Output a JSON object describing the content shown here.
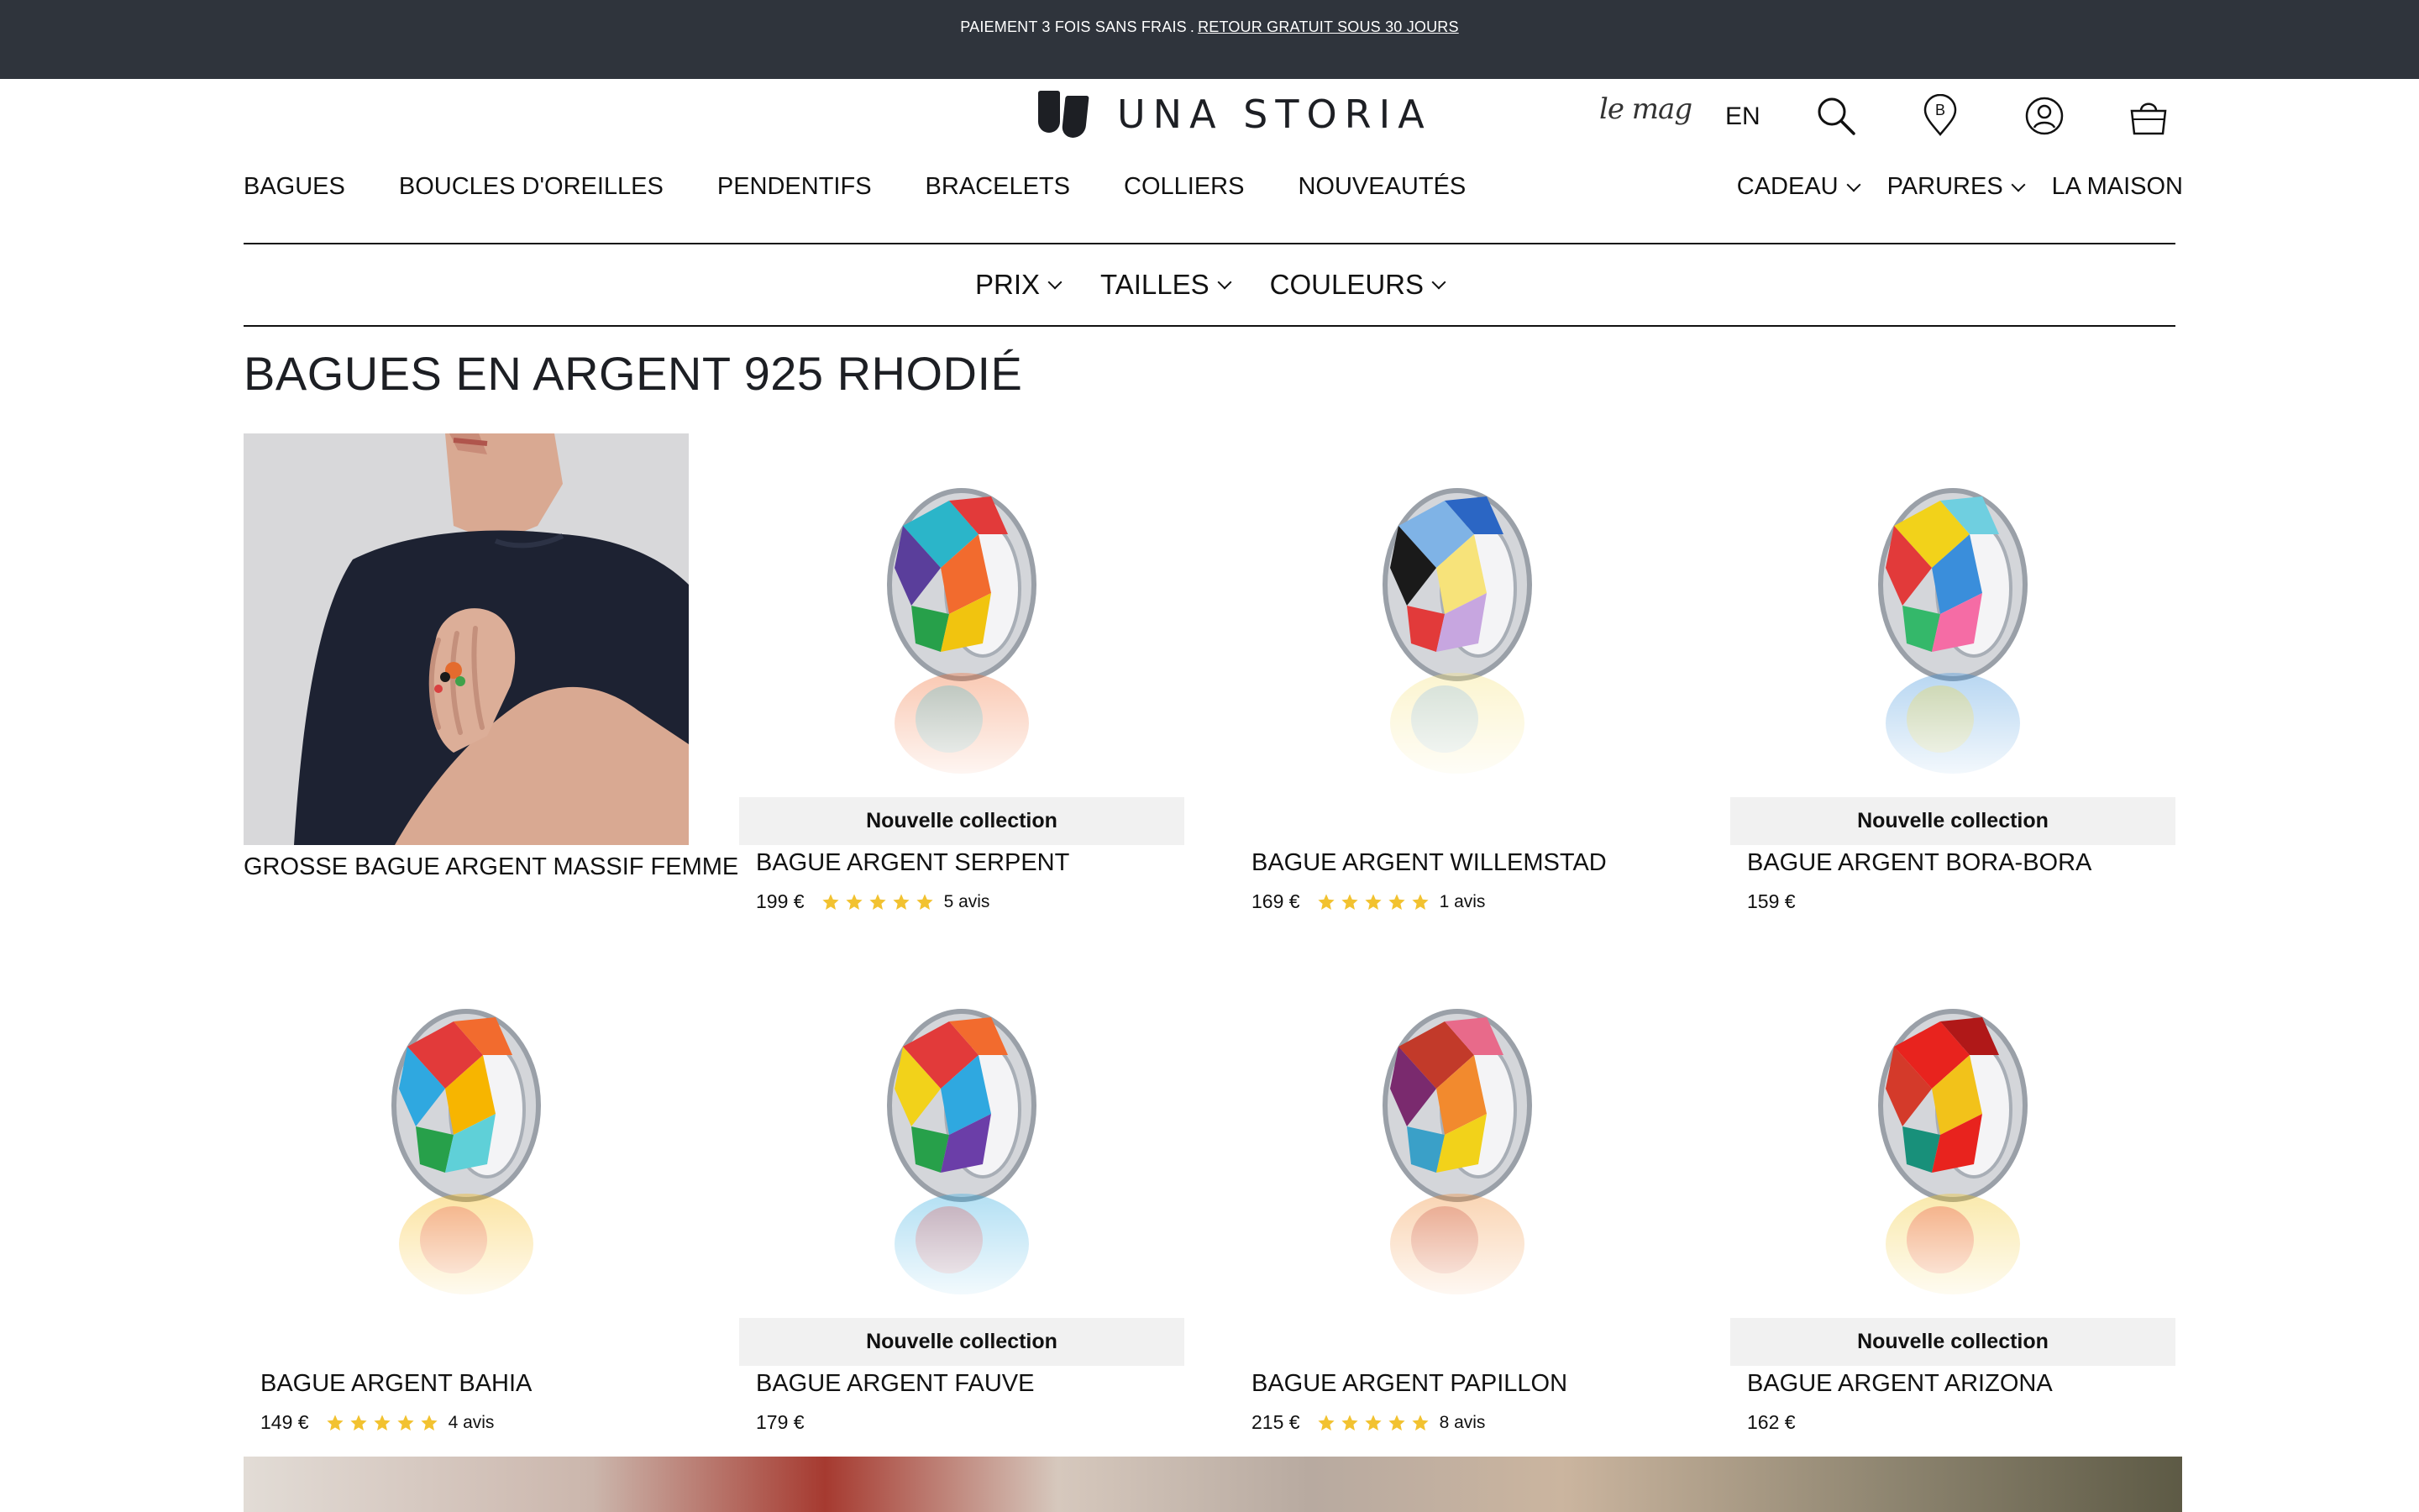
{
  "promo": {
    "text": "PAIEMENT 3 FOIS SANS FRAIS",
    "separator": ".",
    "link": "RETOUR GRATUIT SOUS 30 JOURS"
  },
  "header": {
    "brand": "UNA STORIA",
    "mag_label": "le mag",
    "lang": "EN",
    "icons": [
      "search-icon",
      "store-locator-icon",
      "account-icon",
      "cart-icon"
    ],
    "store_letter": "B"
  },
  "nav": {
    "items": [
      "BAGUES",
      "BOUCLES D'OREILLES",
      "PENDENTIFS",
      "BRACELETS",
      "COLLIERS",
      "NOUVEAUTÉS"
    ],
    "right": [
      "CADEAU",
      "PARURES",
      "LA MAISON"
    ]
  },
  "filters": [
    "PRIX",
    "TAILLES",
    "COULEURS"
  ],
  "page_title": "BAGUES EN ARGENT 925 RHODIÉ",
  "hero": {
    "name": "GROSSE BAGUE ARGENT MASSIF FEMME"
  },
  "products": [
    {
      "name": "BAGUE ARGENT SERPENT",
      "price": "199 €",
      "rating": 5,
      "reviews": "5 avis",
      "badge": "Nouvelle collection"
    },
    {
      "name": "BAGUE ARGENT WILLEMSTAD",
      "price": "169 €",
      "rating": 5,
      "reviews": "1 avis",
      "badge": ""
    },
    {
      "name": "BAGUE ARGENT BORA-BORA",
      "price": "159 €",
      "rating": 0,
      "reviews": "",
      "badge": "Nouvelle collection"
    },
    {
      "name": "BAGUE ARGENT BAHIA",
      "price": "149 €",
      "rating": 5,
      "reviews": "4 avis",
      "badge": ""
    },
    {
      "name": "BAGUE ARGENT FAUVE",
      "price": "179 €",
      "rating": 0,
      "reviews": "",
      "badge": "Nouvelle collection"
    },
    {
      "name": "BAGUE ARGENT PAPILLON",
      "price": "215 €",
      "rating": 5,
      "reviews": "8 avis",
      "badge": ""
    },
    {
      "name": "BAGUE ARGENT ARIZONA",
      "price": "162 €",
      "rating": 0,
      "reviews": "",
      "badge": "Nouvelle collection"
    }
  ],
  "colors": {
    "promo_bg": "#2f343c",
    "badge_bg": "#f1f1f1",
    "star": "#f2c230",
    "text": "#111111"
  }
}
